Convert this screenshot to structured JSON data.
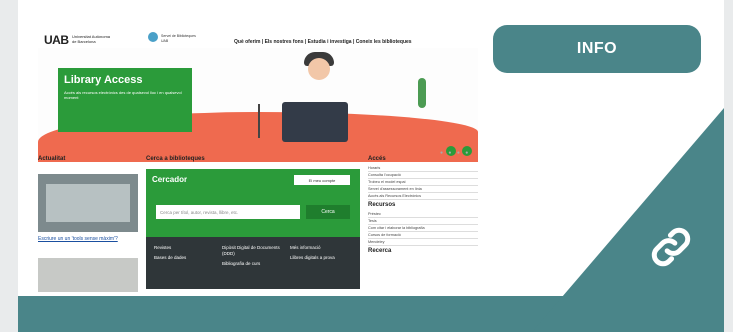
{
  "info_button": {
    "label": "INFO"
  },
  "colors": {
    "teal": "#4a8589",
    "green": "#2b9b3a",
    "coral": "#ef6a4f"
  },
  "icons": {
    "link": "link-icon",
    "user": "user-icon",
    "search": "search-icon"
  },
  "site": {
    "logo": "UAB",
    "logo_sub": "Universitat Autònoma de Barcelona",
    "library_logo_sub": "Servei de Biblioteques UAB",
    "nav": "Què oferim | Els nostres fons | Estudia i investiga | Coneix les biblioteques",
    "hero": {
      "title": "Library Access",
      "text": "Accés als recursos electrònics des de qualsevol lloc i en qualsevol moment"
    },
    "news": {
      "title": "Actualitat",
      "link": "Escriure un un 'tools sense màxim'?"
    },
    "search": {
      "section_title": "Cerca a biblioteques",
      "header": "Cercador",
      "account": "El meu compte",
      "placeholder": "Cerca per títol, autor, revista, llibre, etc.",
      "button": "Cerca",
      "links": [
        "Revistes",
        "Bases de dades",
        "Dipòsit Digital de Documents (DDD)",
        "Bibliografia de curs",
        "Més informació",
        "Llibres digitals a prova"
      ]
    },
    "access": {
      "title": "Accés",
      "items": [
        "Horaris",
        "Consulta l'ocupació",
        "Trobeu el model espai",
        "Servei d'assessorament en línia",
        "Accés als Recursos Electrònics"
      ]
    },
    "resources": {
      "title": "Recursos",
      "items": [
        "Préstec",
        "Tesis",
        "Com citar i elaborar la bibliografia",
        "Cursos de formació",
        "Mendeley"
      ]
    },
    "research": {
      "title": "Recerca"
    }
  }
}
